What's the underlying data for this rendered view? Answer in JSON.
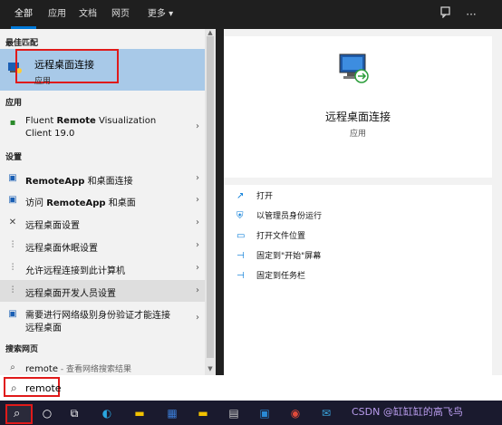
{
  "tabs": [
    "全部",
    "应用",
    "文档",
    "网页",
    "更多"
  ],
  "more_arrow": "▾",
  "sections": {
    "best_match": "最佳匹配",
    "apps": "应用",
    "settings": "设置",
    "web": "搜索网页"
  },
  "best_match": {
    "title": "远程桌面连接",
    "subtitle": "应用"
  },
  "apps": [
    {
      "line1_pre": "Fluent ",
      "line1_bold": "Remote",
      "line1_post": " Visualization",
      "line2": "Client 19.0"
    }
  ],
  "settings": [
    {
      "pre": "",
      "bold": "RemoteApp",
      "post": " 和桌面连接"
    },
    {
      "pre": "访问 ",
      "bold": "RemoteApp",
      "post": " 和桌面"
    },
    {
      "pre": "远程桌面设置",
      "bold": "",
      "post": ""
    },
    {
      "pre": "远程桌面休眠设置",
      "bold": "",
      "post": ""
    },
    {
      "pre": "允许远程连接到此计算机",
      "bold": "",
      "post": ""
    },
    {
      "pre": "远程桌面开发人员设置",
      "bold": "",
      "post": ""
    },
    {
      "pre": "需要进行网络级别身份验证才能连接",
      "bold": "",
      "post": "",
      "line2": "远程桌面"
    }
  ],
  "web_item": {
    "query": "remote",
    "suffix": " - 查看网络搜索结果"
  },
  "detail": {
    "title": "远程桌面连接",
    "subtitle": "应用"
  },
  "actions": [
    "打开",
    "以管理员身份运行",
    "打开文件位置",
    "固定到\"开始\"屏幕",
    "固定到任务栏"
  ],
  "search": {
    "value": "remote"
  },
  "watermark": "CSDN @缸缸缸的高飞鸟",
  "colors": {
    "accent": "#0078d7",
    "highlight": "#a8c9e8",
    "annotation": "#e01a1a"
  }
}
